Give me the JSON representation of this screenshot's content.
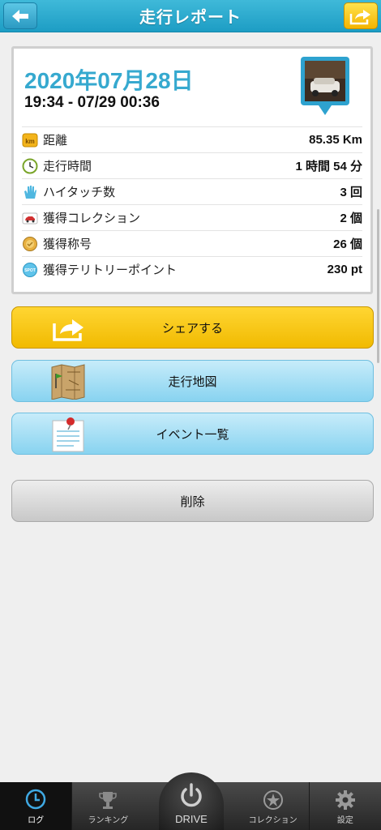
{
  "header": {
    "title": "走行レポート",
    "back_icon": "arrow-left-icon",
    "share_icon": "share-icon"
  },
  "report": {
    "date": "2020年07月28日",
    "time_range": "19:34 - 07/29 00:36",
    "rows": [
      {
        "label": "距離",
        "value": "85.35 Km",
        "icon": "km-icon"
      },
      {
        "label": "走行時間",
        "value": "1 時間 54 分",
        "icon": "clock-icon"
      },
      {
        "label": "ハイタッチ数",
        "value": "3 回",
        "icon": "hand-icon"
      },
      {
        "label": "獲得コレクション",
        "value": "2 個",
        "icon": "car-icon"
      },
      {
        "label": "獲得称号",
        "value": "26 個",
        "icon": "medal-icon"
      },
      {
        "label": "獲得テリトリーポイント",
        "value": "230 pt",
        "icon": "spot-icon"
      }
    ]
  },
  "buttons": {
    "share": "シェアする",
    "map": "走行地図",
    "events": "イベント一覧",
    "delete": "削除"
  },
  "tabbar": {
    "log": "ログ",
    "ranking": "ランキング",
    "drive": "DRIVE",
    "collection": "コレクション",
    "settings": "設定"
  },
  "colors": {
    "header": "#1d9dc4",
    "date": "#36a9cf",
    "share_button": "#f1ba00",
    "blue_button": "#88d3f0"
  }
}
